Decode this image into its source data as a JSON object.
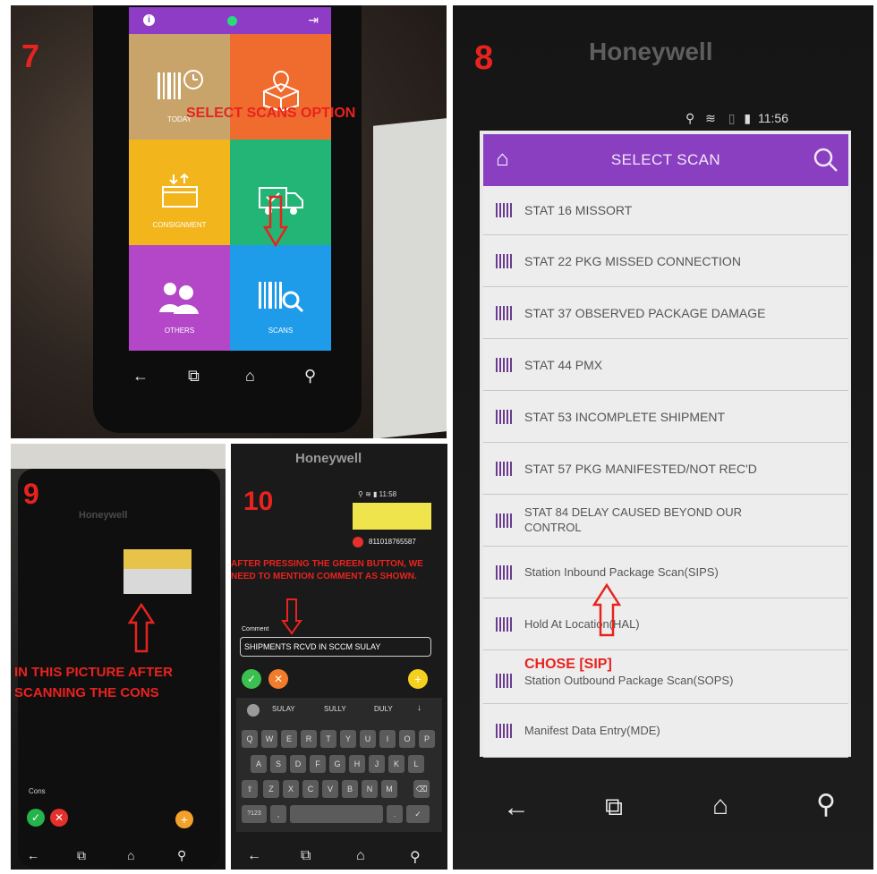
{
  "panel7": {
    "step": "7",
    "instruction": "SELECT SCANS OPTION",
    "tiles": [
      {
        "label": "TODAY"
      },
      {
        "label": ""
      },
      {
        "label": "CONSIGNMENT"
      },
      {
        "label": ""
      },
      {
        "label": "OTHERS"
      },
      {
        "label": "SCANS"
      }
    ],
    "colors": {
      "purple": "#8e3bc6",
      "tan": "#c8a46a",
      "orange": "#ef6b2e",
      "yellow": "#f2b51c",
      "green": "#23b575",
      "violet": "#b347c7",
      "blue": "#1e9be9"
    }
  },
  "panel8": {
    "step": "8",
    "brand": "Honeywell",
    "time": "11:56",
    "title": "SELECT SCAN",
    "items": [
      "STAT 16 MISSORT",
      "STAT 22 PKG MISSED CONNECTION",
      "STAT 37 OBSERVED PACKAGE DAMAGE",
      "STAT 44 PMX",
      "STAT 53 INCOMPLETE SHIPMENT",
      "STAT 57 PKG MANIFESTED/NOT REC'D",
      "STAT 84 DELAY CAUSED BEYOND OUR CONTROL",
      "Station Inbound Package Scan(SIPS)",
      "Hold At Location(HAL)",
      "Station Outbound Package Scan(SOPS)",
      "Manifest Data Entry(MDE)"
    ],
    "note": "CHOSE [SIP]",
    "accent": "#8a3fc1"
  },
  "panel9": {
    "step": "9",
    "brand": "Honeywell",
    "note": "IN THIS PICTURE AFTER SCANNING THE CONS",
    "cons_label": "Cons"
  },
  "panel10": {
    "step": "10",
    "brand": "Honeywell",
    "time": "11:58",
    "tracking": "811018765587",
    "note": "AFTER PRESSING THE GREEN BUTTON, WE NEED TO MENTION COMMENT AS SHOWN.",
    "comment_label": "Comment",
    "comment_value": "SHIPMENTS RCVD IN SCCM SULAY",
    "suggestions": [
      "SULAY",
      "SULLY",
      "DULY"
    ],
    "keys_row1": [
      "Q",
      "W",
      "E",
      "R",
      "T",
      "Y",
      "U",
      "I",
      "O",
      "P"
    ],
    "keys_row2": [
      "A",
      "S",
      "D",
      "F",
      "G",
      "H",
      "J",
      "K",
      "L"
    ],
    "keys_row3": [
      "Z",
      "X",
      "C",
      "V",
      "B",
      "N",
      "M"
    ],
    "key_numbers": "?123"
  }
}
